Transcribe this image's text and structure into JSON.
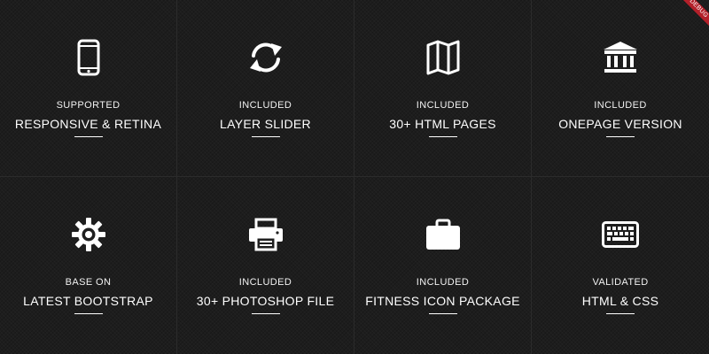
{
  "features": [
    {
      "icon": "smartphone-icon",
      "pretitle": "SUPPORTED",
      "title": "RESPONSIVE & RETINA"
    },
    {
      "icon": "refresh-icon",
      "pretitle": "INCLUDED",
      "title": "LAYER SLIDER"
    },
    {
      "icon": "map-icon",
      "pretitle": "INCLUDED",
      "title": "30+ HTML PAGES"
    },
    {
      "icon": "bank-icon",
      "pretitle": "INCLUDED",
      "title": "ONEPAGE VERSION"
    },
    {
      "icon": "gear-icon",
      "pretitle": "BASE ON",
      "title": "LATEST BOOTSTRAP"
    },
    {
      "icon": "printer-icon",
      "pretitle": "INCLUDED",
      "title": "30+ PHOTOSHOP FILE"
    },
    {
      "icon": "briefcase-icon",
      "pretitle": "INCLUDED",
      "title": "FITNESS ICON PACKAGE"
    },
    {
      "icon": "keyboard-icon",
      "pretitle": "VALIDATED",
      "title": "HTML & CSS"
    }
  ],
  "debug_ribbon": "DEBUG",
  "colors": {
    "background": "#1f1f1f",
    "text": "#ffffff",
    "ribbon": "#b3202a"
  }
}
